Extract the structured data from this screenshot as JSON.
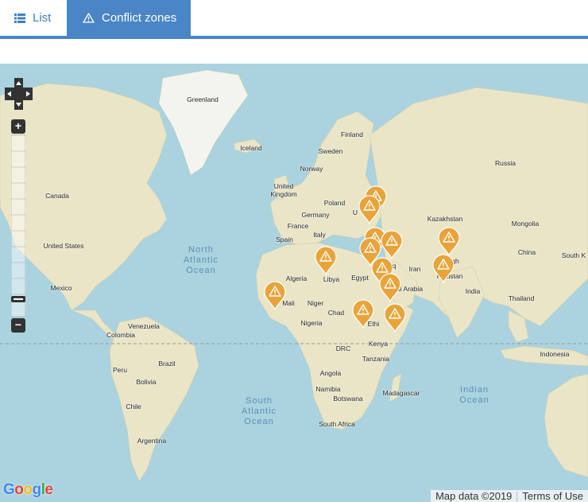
{
  "tabs": {
    "list_label": "List",
    "conflict_label": "Conflict zones"
  },
  "colors": {
    "accent": "#4a86c5",
    "pin": "#e8a43a",
    "water": "#aad3df",
    "land": "#e9e5c6"
  },
  "map": {
    "oceans": {
      "north_atlantic": "North\nAtlantic\nOcean",
      "south_atlantic": "South\nAtlantic\nOcean",
      "indian": "Indian\nOcean"
    },
    "labels": {
      "greenland": "Greenland",
      "iceland": "Iceland",
      "finland": "Finland",
      "sweden": "Sweden",
      "norway": "Norway",
      "russia": "Russia",
      "uk": "United\nKingdom",
      "poland": "Poland",
      "germany": "Germany",
      "france": "France",
      "spain": "Spain",
      "italy": "Italy",
      "kazakhstan": "Kazakhstan",
      "mongolia": "Mongolia",
      "china": "China",
      "south_korea": "South K",
      "canada": "Canada",
      "united_states": "United States",
      "mexico": "Mexico",
      "algeria": "Algeria",
      "libya": "Libya",
      "egypt": "Egypt",
      "iraq": "Iraq",
      "iran": "Iran",
      "india": "India",
      "thailand": "Thailand",
      "mali": "Mali",
      "niger": "Niger",
      "chad": "Chad",
      "nigeria": "Nigeria",
      "saudi": "Saudi Arabia",
      "ethiopia": "Ethi",
      "afghanistan": "Afgh",
      "pakistan": "Pakistan",
      "venezuela": "Venezuela",
      "colombia": "Colombia",
      "peru": "Peru",
      "brazil": "Brazil",
      "bolivia": "Bolivia",
      "chile": "Chile",
      "argentina": "Argentina",
      "drc": "DRC",
      "kenya": "Kenya",
      "tanzania": "Tanzania",
      "angola": "Angola",
      "namibia": "Namibia",
      "botswana": "Botswana",
      "madagascar": "Madagascar",
      "south_africa": "South Africa",
      "indonesia": "Indonesia",
      "ukraine": "U"
    },
    "zoom_in_label": "+",
    "zoom_out_label": "−",
    "google_logo": "Google",
    "attribution": "Map data ©2019",
    "terms": "Terms of Use"
  }
}
